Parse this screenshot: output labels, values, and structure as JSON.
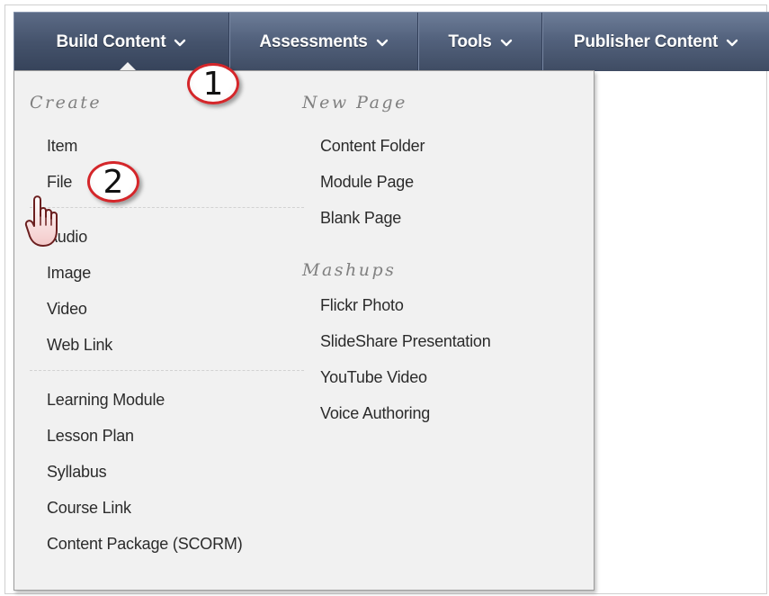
{
  "navbar": {
    "tabs": [
      {
        "label": "Build Content"
      },
      {
        "label": "Assessments"
      },
      {
        "label": "Tools"
      },
      {
        "label": "Publisher Content"
      }
    ]
  },
  "dropdown": {
    "create": {
      "heading": "Create",
      "group1": [
        "Item",
        "File",
        "Audio",
        "Image",
        "Video",
        "Web Link"
      ],
      "group2": [
        "Learning Module",
        "Lesson Plan",
        "Syllabus",
        "Course Link",
        "Content Package (SCORM)"
      ]
    },
    "new_page": {
      "heading": "New Page",
      "items": [
        "Content Folder",
        "Module Page",
        "Blank Page"
      ]
    },
    "mashups": {
      "heading": "Mashups",
      "items": [
        "Flickr Photo",
        "SlideShare Presentation",
        "YouTube Video",
        "Voice Authoring"
      ]
    }
  },
  "callouts": [
    "1",
    "2"
  ],
  "icons": {
    "chevron": "chevron-down-icon",
    "cursor": "hand-pointer-icon"
  },
  "colors": {
    "navbar": "#53627d",
    "menu_bg": "#f1f1f1",
    "callout_border": "#d4262a"
  }
}
